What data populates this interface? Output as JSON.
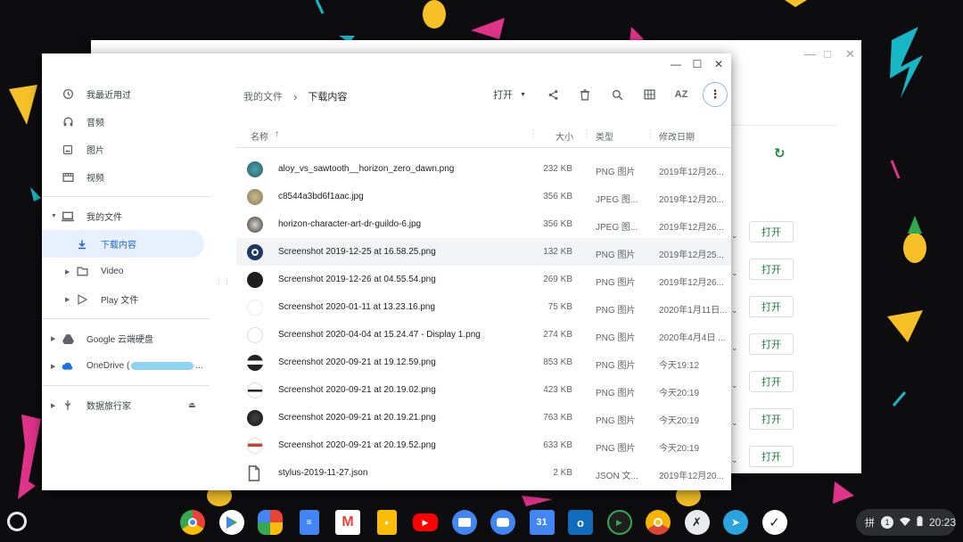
{
  "files_window": {
    "sidebar": {
      "items": [
        {
          "label": "我最近用过",
          "icon": "clock-icon"
        },
        {
          "label": "音频",
          "icon": "headphones-icon"
        },
        {
          "label": "图片",
          "icon": "image-icon"
        },
        {
          "label": "视频",
          "icon": "video-icon"
        }
      ],
      "my_files": "我的文件",
      "downloads": "下载内容",
      "video_folder": "Video",
      "play_files": "Play 文件",
      "google_drive": "Google 云端硬盘",
      "onedrive": "OneDrive (",
      "onedrive_suffix": "...",
      "removable": "数据旅行家"
    },
    "breadcrumb": {
      "root": "我的文件",
      "separator": "›",
      "current": "下载内容"
    },
    "toolbar": {
      "open_label": "打开",
      "sort_label": "AZ"
    },
    "table": {
      "headers": {
        "name": "名称",
        "size": "大小",
        "type": "类型",
        "date": "修改日期"
      },
      "rows": [
        {
          "name": "aloy_vs_sawtooth__horizon_zero_dawn.png",
          "size": "232 KB",
          "type": "PNG 图片",
          "date": "2019年12月26..."
        },
        {
          "name": "c8544a3bd6f1aac.jpg",
          "size": "356 KB",
          "type": "JPEG 图...",
          "date": "2019年12月20..."
        },
        {
          "name": "horizon-character-art-dr-guildo-6.jpg",
          "size": "356 KB",
          "type": "JPEG 图...",
          "date": "2019年12月26..."
        },
        {
          "name": "Screenshot 2019-12-25 at 16.58.25.png",
          "size": "132 KB",
          "type": "PNG 图片",
          "date": "2019年12月25..."
        },
        {
          "name": "Screenshot 2019-12-26 at 04.55.54.png",
          "size": "269 KB",
          "type": "PNG 图片",
          "date": "2019年12月26..."
        },
        {
          "name": "Screenshot 2020-01-11 at 13.23.16.png",
          "size": "75 KB",
          "type": "PNG 图片",
          "date": "2020年1月11日..."
        },
        {
          "name": "Screenshot 2020-04-04 at 15.24.47 - Display 1.png",
          "size": "274 KB",
          "type": "PNG 图片",
          "date": "2020年4月4日 ..."
        },
        {
          "name": "Screenshot 2020-09-21 at 19.12.59.png",
          "size": "853 KB",
          "type": "PNG 图片",
          "date": "今天19:12"
        },
        {
          "name": "Screenshot 2020-09-21 at 20.19.02.png",
          "size": "423 KB",
          "type": "PNG 图片",
          "date": "今天20:19"
        },
        {
          "name": "Screenshot 2020-09-21 at 20.19.21.png",
          "size": "763 KB",
          "type": "PNG 图片",
          "date": "今天20:19"
        },
        {
          "name": "Screenshot 2020-09-21 at 20.19.52.png",
          "size": "633 KB",
          "type": "PNG 图片",
          "date": "今天20:19"
        },
        {
          "name": "stylus-2019-11-27.json",
          "size": "2 KB",
          "type": "JSON 文...",
          "date": "2019年12月20..."
        }
      ]
    }
  },
  "background_window": {
    "open_button_label": "打开"
  },
  "shelf": {
    "apps": [
      "chrome-icon",
      "play-store-icon",
      "photos-icon",
      "docs-icon",
      "gmail-icon",
      "keep-icon",
      "youtube-icon",
      "files-icon",
      "messages-icon",
      "calendar-icon",
      "outlook-icon",
      "player-icon",
      "chrome-canary-icon",
      "app-x-icon",
      "telegram-icon",
      "app-v-icon"
    ],
    "calendar_day": "31",
    "tray": {
      "ime": "拼",
      "notification_count": "1",
      "time": "20:23"
    }
  },
  "colors": {
    "accent": "#1a73e8",
    "selected_bg": "#e8f0fe",
    "open_green": "#188038"
  }
}
